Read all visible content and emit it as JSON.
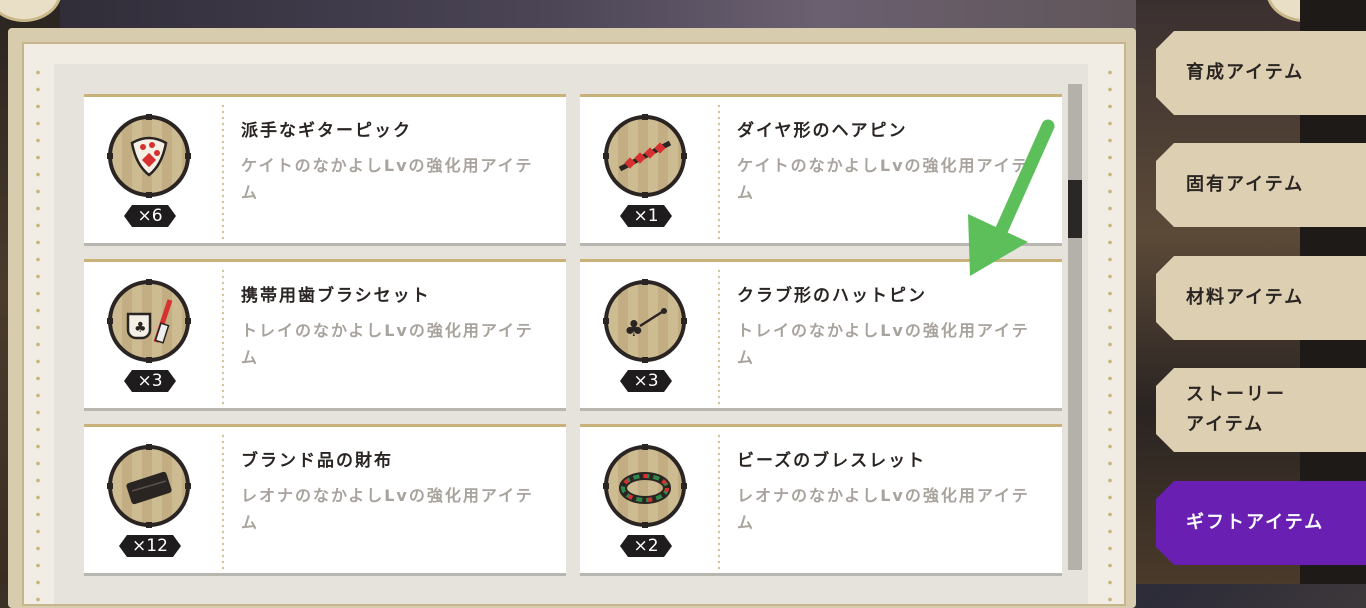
{
  "tabs": [
    {
      "label": "育成アイテム"
    },
    {
      "label": "固有アイテム"
    },
    {
      "label": "材料アイテム"
    },
    {
      "label": "ストーリー\nアイテム"
    },
    {
      "label": "ギフトアイテム",
      "active": true
    }
  ],
  "items": [
    {
      "name": "派手なギターピック",
      "desc": "ケイトのなかよしLvの強化用アイテム",
      "count": "×6",
      "icon": "guitar-pick-icon"
    },
    {
      "name": "ダイヤ形のヘアピン",
      "desc": "ケイトのなかよしLvの強化用アイテム",
      "count": "×1",
      "icon": "diamond-hairpin-icon"
    },
    {
      "name": "携帯用歯ブラシセット",
      "desc": "トレイのなかよしLvの強化用アイテム",
      "count": "×3",
      "icon": "toothbrush-set-icon"
    },
    {
      "name": "クラブ形のハットピン",
      "desc": "トレイのなかよしLvの強化用アイテム",
      "count": "×3",
      "icon": "club-hatpin-icon"
    },
    {
      "name": "ブランド品の財布",
      "desc": "レオナのなかよしLvの強化用アイテム",
      "count": "×12",
      "icon": "wallet-icon"
    },
    {
      "name": "ビーズのブレスレット",
      "desc": "レオナのなかよしLvの強化用アイテム",
      "count": "×2",
      "icon": "bead-bracelet-icon"
    }
  ],
  "colors": {
    "active_tab": "#6a1fb3",
    "arrow": "#5cbf5a",
    "panel_border": "#c6b58a"
  }
}
